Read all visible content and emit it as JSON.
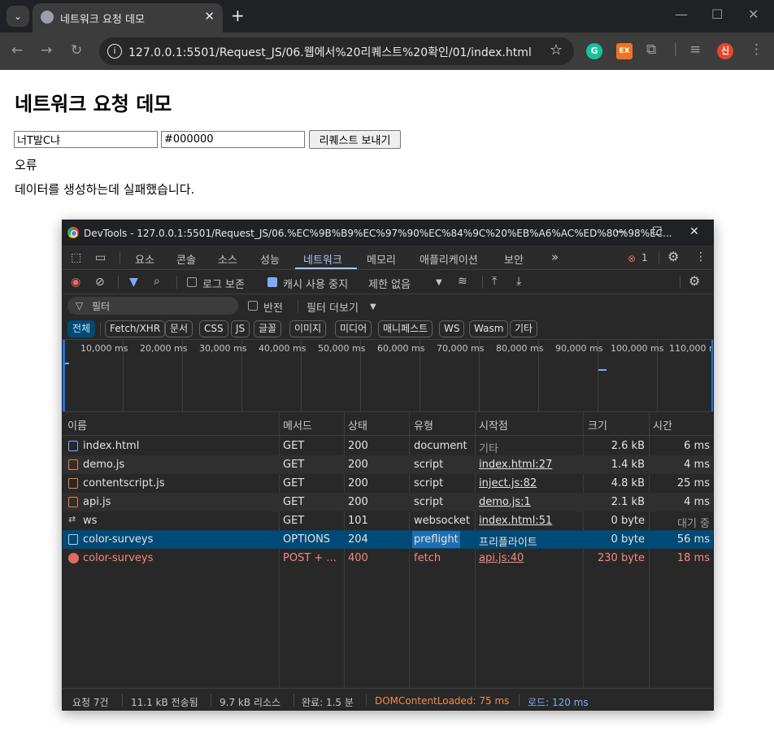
{
  "browser": {
    "tab_title": "네트워크 요청 데모",
    "url": "127.0.0.1:5501/Request_JS/06.웹에서%20리퀘스트%20확인/01/index.html",
    "extensions": [
      "G",
      "EX"
    ],
    "profile_initial": "신"
  },
  "page": {
    "title": "네트워크 요청 데모",
    "input_text": "너T발C냐",
    "input_color": "#000000",
    "send_button": "리퀘스트 보내기",
    "error_label": "오류",
    "error_message": "데이터를 생성하는데 실패했습니다."
  },
  "devtools": {
    "window_title": "DevTools - 127.0.0.1:5501/Request_JS/06.%EC%9B%B9%EC%97%90%EC%84%9C%20%EB%A6%AC%ED%80%98%EC...",
    "tabs": [
      "요소",
      "콘솔",
      "소스",
      "성능",
      "네트워크",
      "메모리",
      "애플리케이션",
      "보안"
    ],
    "active_tab": "네트워크",
    "error_count": "1",
    "toolbar": {
      "preserve_log": "로그 보존",
      "disable_cache": "캐시 사용 중지",
      "throttle": "제한 없음"
    },
    "filter": {
      "placeholder": "필터",
      "invert": "반전",
      "more_filters": "필터 더보기"
    },
    "type_filters": [
      "전체",
      "Fetch/XHR",
      "문서",
      "CSS",
      "JS",
      "글꼴",
      "이미지",
      "미디어",
      "매니페스트",
      "WS",
      "Wasm",
      "기타"
    ],
    "overview_ticks": [
      "10,000 ms",
      "20,000 ms",
      "30,000 ms",
      "40,000 ms",
      "50,000 ms",
      "60,000 ms",
      "70,000 ms",
      "80,000 ms",
      "90,000 ms",
      "100,000 ms",
      "110,000 m"
    ],
    "columns": [
      "이름",
      "메서드",
      "상태",
      "유형",
      "시작점",
      "크기",
      "시간"
    ],
    "rows": [
      {
        "name": "index.html",
        "method": "GET",
        "status": "200",
        "type": "document",
        "initiator": "기타",
        "size": "2.6 kB",
        "time": "6 ms"
      },
      {
        "name": "demo.js",
        "method": "GET",
        "status": "200",
        "type": "script",
        "initiator": "index.html:27",
        "size": "1.4 kB",
        "time": "4 ms"
      },
      {
        "name": "contentscript.js",
        "method": "GET",
        "status": "200",
        "type": "script",
        "initiator": "inject.js:82",
        "size": "4.8 kB",
        "time": "25 ms"
      },
      {
        "name": "api.js",
        "method": "GET",
        "status": "200",
        "type": "script",
        "initiator": "demo.js:1",
        "size": "2.1 kB",
        "time": "4 ms"
      },
      {
        "name": "ws",
        "method": "GET",
        "status": "101",
        "type": "websocket",
        "initiator": "index.html:51",
        "size": "0 byte",
        "time": "대기 중"
      },
      {
        "name": "color-surveys",
        "method": "OPTIONS",
        "status": "204",
        "type": "preflight",
        "initiator": "프리플라이트",
        "size": "0 byte",
        "time": "56 ms"
      },
      {
        "name": "color-surveys",
        "method": "POST + ...",
        "status": "400",
        "type": "fetch",
        "initiator": "api.js:40",
        "size": "230 byte",
        "time": "18 ms"
      }
    ],
    "statusbar": {
      "requests": "요청 7건",
      "transferred": "11.1 kB 전송됨",
      "resources": "9.7 kB 리소스",
      "finish": "완료: 1.5 분",
      "dcl": "DOMContentLoaded: 75 ms",
      "load": "로드: 120 ms"
    },
    "colors": {
      "accent": "#a8c7fa",
      "selected_row": "#004a77",
      "error": "#f28b82",
      "dcl": "#f28b50",
      "load": "#7cacf8"
    }
  }
}
